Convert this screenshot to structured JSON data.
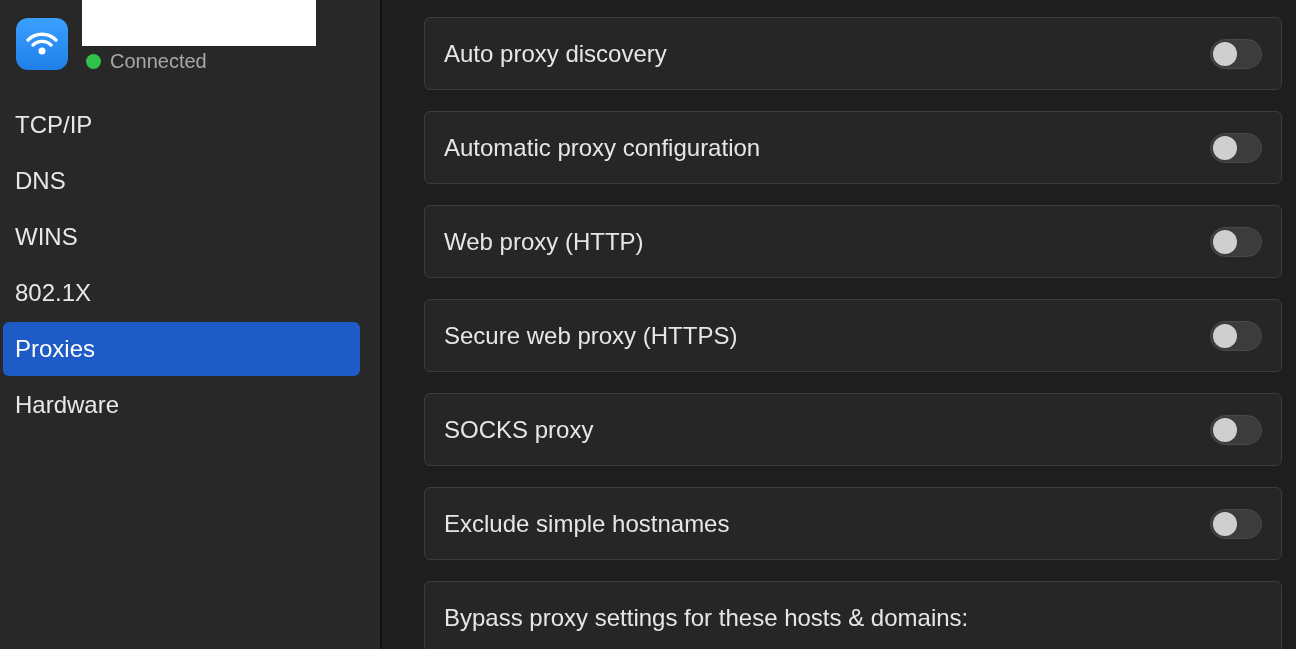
{
  "connection": {
    "status": "Connected",
    "connected": true
  },
  "sidebar": {
    "items": [
      {
        "label": "TCP/IP",
        "selected": false
      },
      {
        "label": "DNS",
        "selected": false
      },
      {
        "label": "WINS",
        "selected": false
      },
      {
        "label": "802.1X",
        "selected": false
      },
      {
        "label": "Proxies",
        "selected": true
      },
      {
        "label": "Hardware",
        "selected": false
      }
    ]
  },
  "proxies": [
    {
      "kind": "toggle",
      "label": "Auto proxy discovery",
      "on": false
    },
    {
      "kind": "toggle",
      "label": "Automatic proxy configuration",
      "on": false
    },
    {
      "kind": "toggle",
      "label": "Web proxy (HTTP)",
      "on": false
    },
    {
      "kind": "toggle",
      "label": "Secure web proxy (HTTPS)",
      "on": false
    },
    {
      "kind": "toggle",
      "label": "SOCKS proxy",
      "on": false
    },
    {
      "kind": "toggle",
      "label": "Exclude simple hostnames",
      "on": false
    },
    {
      "kind": "heading",
      "label": "Bypass proxy settings for these hosts & domains:"
    }
  ]
}
